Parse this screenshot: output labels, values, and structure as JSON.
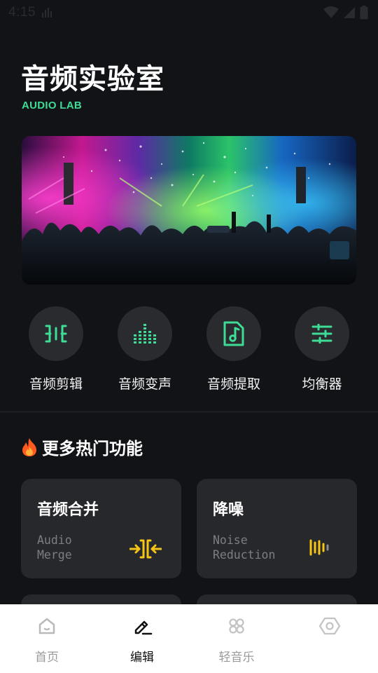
{
  "status_bar": {
    "time": "4:15"
  },
  "header": {
    "title": "音频实验室",
    "subtitle": "AUDIO LAB"
  },
  "tools": [
    {
      "label": "音频剪辑",
      "icon": "audio-cut-icon"
    },
    {
      "label": "音频变声",
      "icon": "equalizer-bars-icon"
    },
    {
      "label": "音频提取",
      "icon": "music-file-icon"
    },
    {
      "label": "均衡器",
      "icon": "sliders-icon"
    }
  ],
  "hot_section": {
    "title": "更多热门功能",
    "icon": "fire-icon"
  },
  "cards": [
    {
      "title": "音频合并",
      "subtitle_line1": "Audio",
      "subtitle_line2": "Merge",
      "icon": "merge-icon",
      "icon_color": "#f5c518"
    },
    {
      "title": "降噪",
      "subtitle_line1": "Noise",
      "subtitle_line2": "Reduction",
      "icon": "noise-bars-icon",
      "icon_color": "#f5c518"
    }
  ],
  "bottom_nav": [
    {
      "label": "首页",
      "icon": "home-icon",
      "active": false
    },
    {
      "label": "编辑",
      "icon": "edit-icon",
      "active": true
    },
    {
      "label": "轻音乐",
      "icon": "grid-icon",
      "active": false
    },
    {
      "label": "",
      "icon": "settings-hexagon-icon",
      "active": false
    }
  ],
  "colors": {
    "accent": "#3ddc97",
    "background": "#121316",
    "card": "#27282c",
    "highlight": "#f5c518"
  }
}
